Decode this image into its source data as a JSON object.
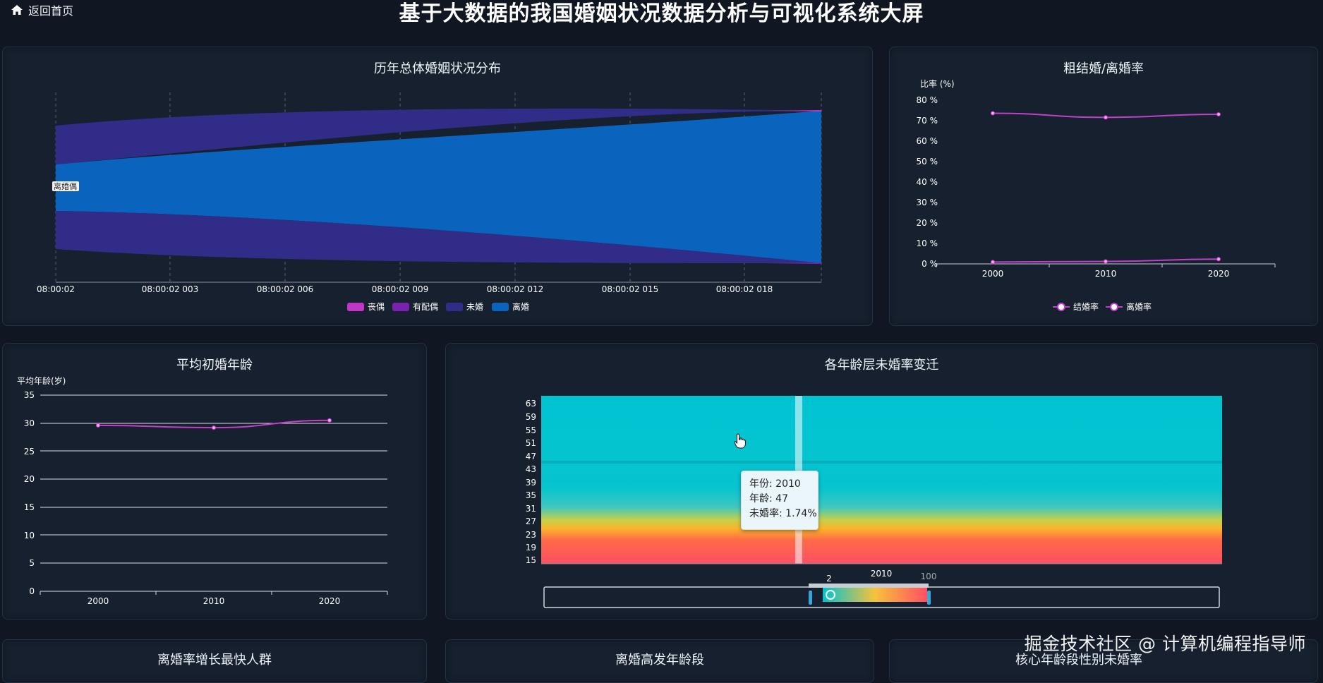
{
  "header": {
    "back_label": "返回首页",
    "title": "基于大数据的我国婚姻状况数据分析与可视化系统大屏"
  },
  "panels": {
    "marital_distribution": {
      "title": "历年总体婚姻状况分布",
      "x_ticks": [
        "08:00:02",
        "08:00:02 003",
        "08:00:02 006",
        "08:00:02 009",
        "08:00:02 012",
        "08:00:02 015",
        "08:00:02 018"
      ],
      "hover_label": "离婚偶",
      "legend": [
        "丧偶",
        "有配偶",
        "未婚",
        "离婚"
      ]
    },
    "crude_rates": {
      "title": "粗结婚/离婚率",
      "y_name": "比率 (%)",
      "y_ticks": [
        "0 %",
        "10 %",
        "20 %",
        "30 %",
        "40 %",
        "50 %",
        "60 %",
        "70 %",
        "80 %"
      ],
      "x_ticks": [
        "2000",
        "2010",
        "2020"
      ],
      "legend": [
        "结婚率",
        "离婚率"
      ]
    },
    "first_marriage_age": {
      "title": "平均初婚年龄",
      "y_name": "平均年龄(岁)",
      "y_ticks": [
        "0",
        "5",
        "10",
        "15",
        "20",
        "25",
        "30",
        "35"
      ],
      "x_ticks": [
        "2000",
        "2010",
        "2020"
      ]
    },
    "unmarried_heatmap": {
      "title": "各年龄层未婚率变迁",
      "y_ticks": [
        "63",
        "59",
        "55",
        "51",
        "47",
        "43",
        "39",
        "35",
        "31",
        "27",
        "23",
        "19",
        "15"
      ],
      "x_tick": "2010",
      "visual_map": {
        "min_label": "2",
        "max_label": "100"
      }
    },
    "bottom": {
      "left_title": "离婚率增长最快人群",
      "mid_title": "离婚高发年龄段",
      "right_title": "核心年龄段性别未婚率"
    }
  },
  "tooltip": {
    "year": "年份: 2010",
    "age": "年龄: 47",
    "rate": "未婚率: 1.74%"
  },
  "watermark": "掘金技术社区 @ 计算机编程指导师",
  "colors": {
    "background": "#101722",
    "panel": "#16202e",
    "widowed": "#c236c5",
    "married": "#7a22b0",
    "unmarried": "#302c88",
    "divorced": "#0a63bd",
    "line": "#c23fc8"
  },
  "chart_data": [
    {
      "type": "area",
      "title": "历年总体婚姻状况分布",
      "note": "streamgraph",
      "series": [
        {
          "name": "丧偶"
        },
        {
          "name": "有配偶"
        },
        {
          "name": "未婚"
        },
        {
          "name": "离婚"
        }
      ]
    },
    {
      "type": "line",
      "title": "粗结婚/离婚率",
      "ylabel": "比率 (%)",
      "categories": [
        "2000",
        "2010",
        "2020"
      ],
      "ylim": [
        0,
        80
      ],
      "series": [
        {
          "name": "结婚率",
          "values": [
            73,
            71,
            72.5
          ]
        },
        {
          "name": "离婚率",
          "values": [
            0.9,
            1.2,
            2.3
          ]
        }
      ],
      "legend": "bottom-center"
    },
    {
      "type": "line",
      "title": "平均初婚年龄",
      "ylabel": "平均年龄(岁)",
      "categories": [
        "2000",
        "2010",
        "2020"
      ],
      "ylim": [
        0,
        35
      ],
      "series": [
        {
          "values": [
            29.6,
            29.2,
            30.5
          ]
        }
      ]
    },
    {
      "type": "heatmap",
      "title": "各年龄层未婚率变迁",
      "x": [
        "2010"
      ],
      "ylim": [
        15,
        63
      ],
      "visual_range": [
        2,
        100
      ],
      "highlight": {
        "year": "2010",
        "age": 47,
        "value": 1.74
      }
    }
  ]
}
